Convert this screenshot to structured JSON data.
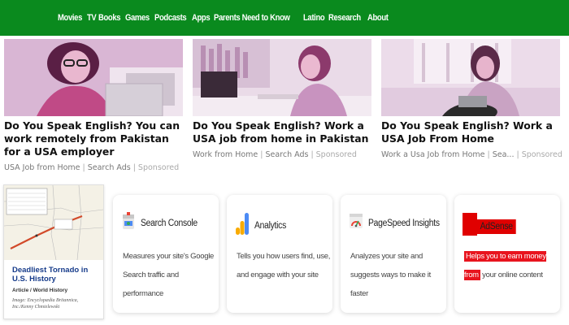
{
  "nav": {
    "items": [
      "Movies",
      "TV",
      "Books",
      "Games",
      "Podcasts",
      "Apps",
      "Parents Need to Know",
      "Latino",
      "Research",
      "About"
    ]
  },
  "ads": [
    {
      "title": "Do You Speak English? You can work remotely from Pakistan for a USA employer",
      "source": "USA Job from Home",
      "cta": "Search Ads",
      "sponsored": "Sponsored"
    },
    {
      "title": "Do You Speak English? Work a USA job from home in Pakistan",
      "source": "Work from Home",
      "cta": "Search Ads",
      "sponsored": "Sponsored"
    },
    {
      "title": "Do You Speak English? Work a USA Job From Home",
      "source": "Work a Usa Job from Home",
      "cta": "Sea...",
      "sponsored": "Sponsored"
    }
  ],
  "map_card": {
    "title": "Deadliest Tornado in U.S. History",
    "category": "Article / World History",
    "credit": "Image: Encyclopædia Britannica, Inc./Kenny Chmielewski"
  },
  "tools": [
    {
      "name": "Search Console",
      "icon": "search-console-icon",
      "desc": "Measures your site's Google Search traffic and performance"
    },
    {
      "name": "Analytics",
      "icon": "analytics-icon",
      "desc": "Tells you how users find, use, and engage with your site"
    },
    {
      "name": "PageSpeed Insights",
      "icon": "pagespeed-icon",
      "desc": "Analyzes your site and suggests ways to make it faster"
    },
    {
      "name": "AdSense",
      "icon": "adsense-icon",
      "desc_highlight": "Helps you to earn money from",
      "desc_rest": "your online content"
    }
  ],
  "colors": {
    "nav_bg": "#0a8a1e",
    "map_title": "#163b8a",
    "adsense_red": "#e00000"
  }
}
